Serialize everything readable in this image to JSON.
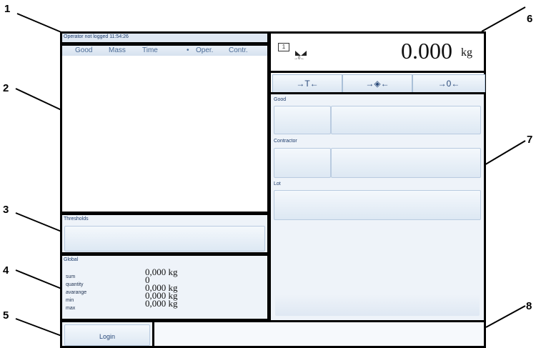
{
  "callouts": [
    "1",
    "2",
    "3",
    "4",
    "5",
    "6",
    "7",
    "8"
  ],
  "status_bar": {
    "text": "Operator not logged 11:54:26"
  },
  "table": {
    "columns": [
      "Good",
      "Mass",
      "Time",
      "Oper.",
      "Contr."
    ],
    "sort_indicator": "•"
  },
  "thresholds": {
    "label": "Thresholds"
  },
  "global": {
    "label": "Global",
    "stats": [
      {
        "label": "sum",
        "value": "0,000 kg"
      },
      {
        "label": "quantity",
        "value": "0"
      },
      {
        "label": "avarange",
        "value": "0,000 kg"
      },
      {
        "label": "min",
        "value": "0,000 kg"
      },
      {
        "label": "max",
        "value": "0,000 kg"
      }
    ]
  },
  "login": {
    "label": "Login"
  },
  "scale": {
    "reading": "0.000",
    "unit": "kg",
    "range_icon": "range-1-icon",
    "zero_indicator": "→0←"
  },
  "scale_buttons": {
    "tare": "→T←",
    "center": "→◈←",
    "zero": "→0←"
  },
  "fields": {
    "good": "Good",
    "contractor": "Contractor",
    "lot": "Lot"
  },
  "colors": {
    "border": "#000000",
    "panel_bg": "#eef3f9",
    "accent": "#2a4a7a"
  }
}
